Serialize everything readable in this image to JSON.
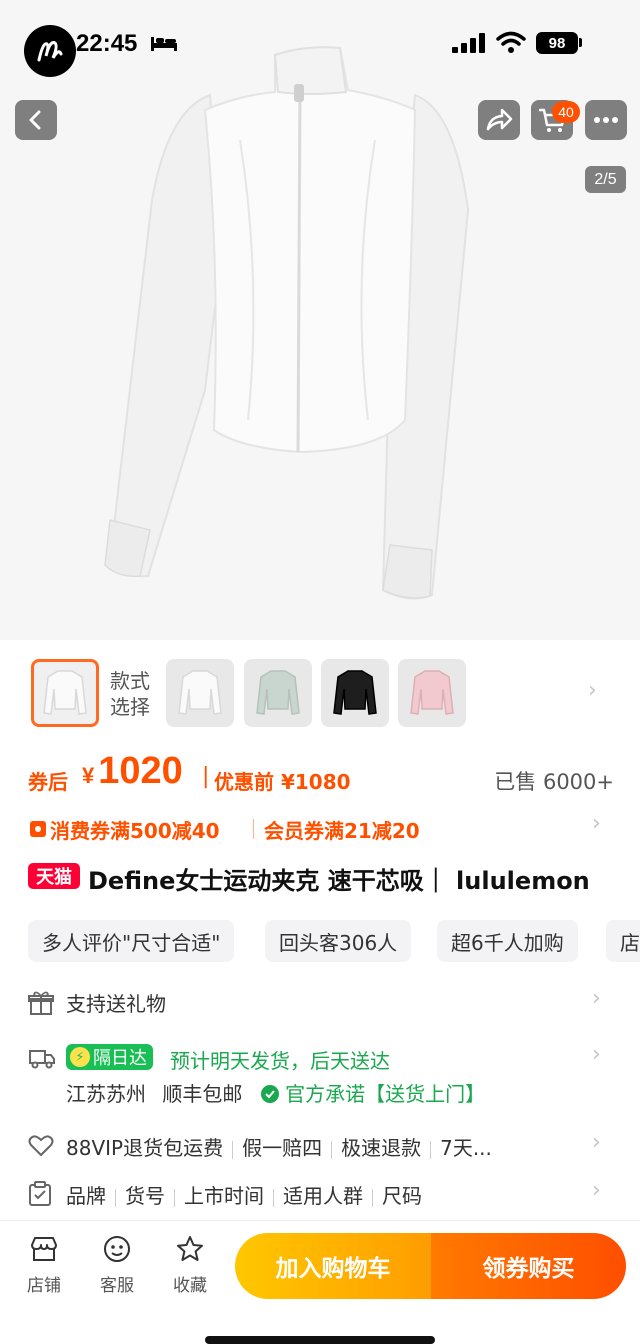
{
  "status_bar": {
    "time": "22:45",
    "battery": "98"
  },
  "header": {
    "cart_count": "40",
    "page_indicator": "2/5"
  },
  "variants": {
    "label": "款式选择",
    "items": [
      {
        "color": "#f4f4f4",
        "selected": true
      },
      {
        "color": "#f4f4f4",
        "selected": false
      },
      {
        "color": "#c9d6d0",
        "selected": false
      },
      {
        "color": "#1e1e1e",
        "selected": false
      },
      {
        "color": "#f2c9cf",
        "selected": false
      }
    ]
  },
  "price": {
    "after_coupon_label": "券后",
    "currency": "¥",
    "after_coupon_value": "1020",
    "separator": "|",
    "before_label": "优惠前 ¥1080",
    "sold": "已售 6000+"
  },
  "coupons": {
    "consumer": "消费券满500减40",
    "member": "会员券满21减20"
  },
  "title": {
    "store_tag": "天猫",
    "text": "Define女士运动夹克  速干芯吸｜ lululemon"
  },
  "tags": [
    "多人评价\"尺寸合适\"",
    "回头客306人",
    "超6千人加购",
    "店"
  ],
  "services": {
    "gift": "支持送礼物",
    "delivery_tag": "隔日达",
    "delivery_eta": "预计明天发货，后天送达",
    "origin": "江苏苏州",
    "shipping": "顺丰包邮",
    "promise": "官方承诺【送货上门】",
    "guarantees": [
      "88VIP退货包运费",
      "假一赔四",
      "极速退款",
      "7天..."
    ],
    "params": [
      "品牌",
      "货号",
      "上市时间",
      "适用人群",
      "尺码"
    ]
  },
  "bottom_bar": {
    "store": "店铺",
    "service": "客服",
    "favorite": "收藏",
    "add_to_cart": "加入购物车",
    "buy": "领券购买"
  },
  "colors": {
    "accent": "#ff5000",
    "tmall": "#ff0036",
    "green": "#19a84e"
  }
}
